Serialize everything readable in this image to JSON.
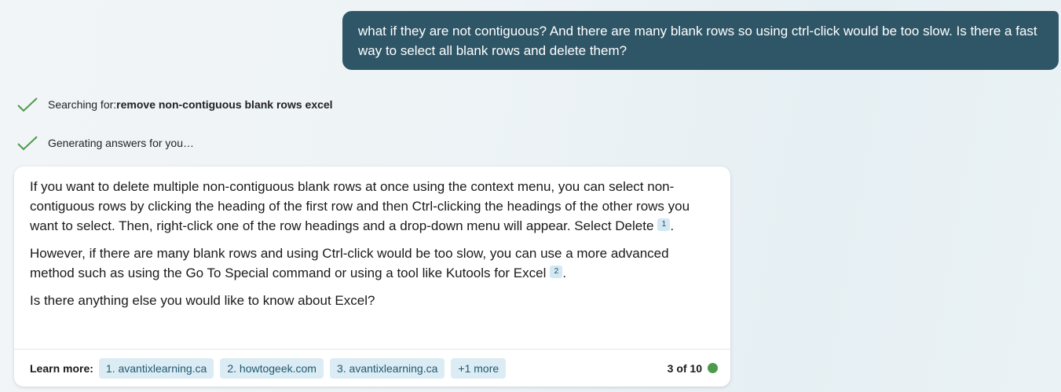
{
  "user_message": {
    "text": "what if they are not contiguous? And there are many blank rows so using ctrl-click would be too slow. Is there a fast way to select all blank rows and delete them?"
  },
  "status": {
    "search_prefix": "Searching for: ",
    "search_query": "remove non-contiguous blank rows excel",
    "generating": "Generating answers for you…"
  },
  "answer": {
    "p1": "If you want to delete multiple non-contiguous blank rows at once using the context menu, you can select non-contiguous rows by clicking the heading of the first row and then Ctrl-clicking the headings of the other rows you want to select. Then, right-click one of the row headings and a drop-down menu will appear. Select Delete",
    "p1_cite": "1",
    "p2": "However, if there are many blank rows and using Ctrl-click would be too slow, you can use a more advanced method such as using the Go To Special command or using a tool like Kutools for Excel",
    "p2_cite": "2",
    "p3": "Is there anything else you would like to know about Excel?"
  },
  "learn_more": {
    "label": "Learn more:",
    "sources": [
      "1. avantixlearning.ca",
      "2. howtogeek.com",
      "3. avantixlearning.ca"
    ],
    "more": "+1 more",
    "counter": "3 of 10"
  },
  "icons": {
    "check": "check-icon",
    "status_dot": "status-dot-icon"
  },
  "colors": {
    "user_bubble": "#2f5667",
    "check": "#4c9a4c",
    "chip_bg": "#dbecf4",
    "chip_text": "#22596f",
    "status_dot": "#4c9a4c"
  }
}
